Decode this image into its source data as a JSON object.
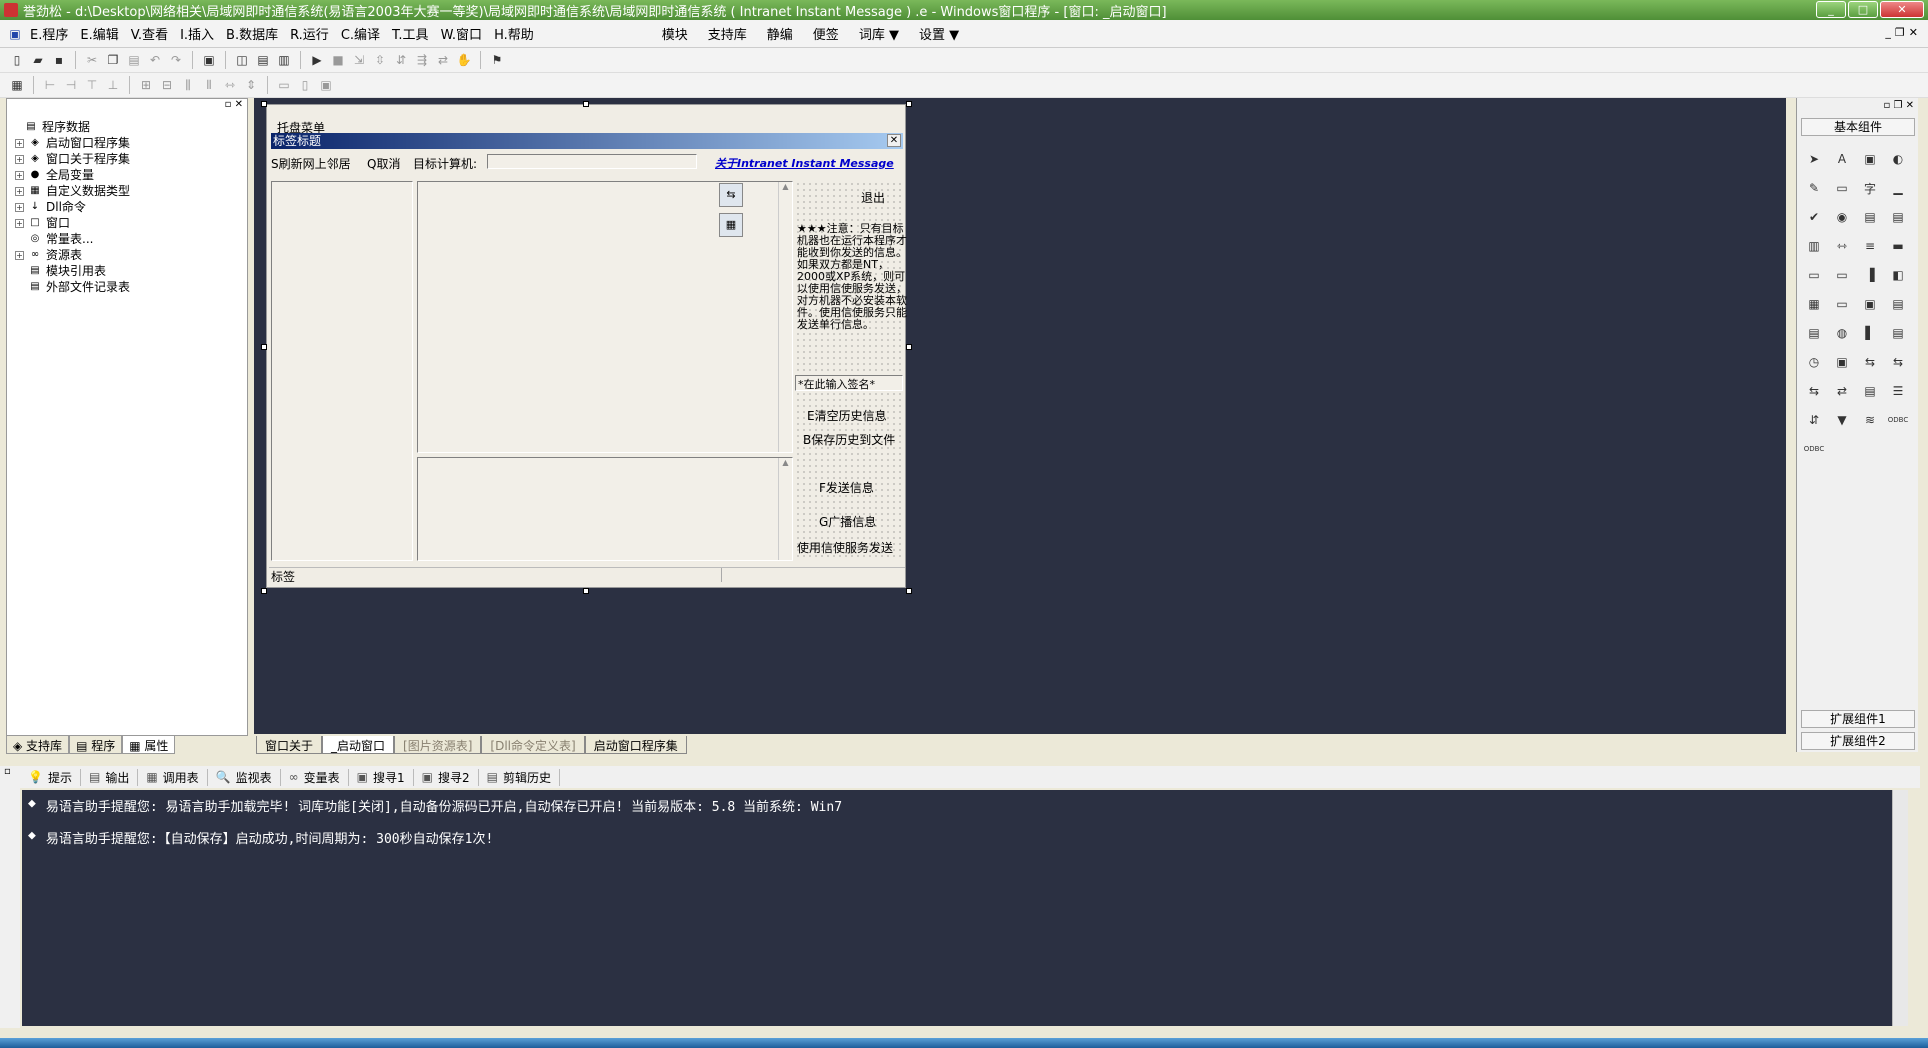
{
  "window": {
    "title": "誉劲松 - d:\\Desktop\\网络相关\\局域网即时通信系统(易语言2003年大赛一等奖)\\局域网即时通信系统\\局域网即时通信系统 ( Intranet Instant Message ) .e - Windows窗口程序 - [窗口: _启动窗口]",
    "controls": {
      "minimize": "_",
      "restore": "□",
      "close": "✕"
    }
  },
  "menubar": {
    "items": [
      "E.程序",
      "E.编辑",
      "V.查看",
      "I.插入",
      "B.数据库",
      "R.运行",
      "C.编译",
      "T.工具",
      "W.窗口",
      "H.帮助"
    ],
    "right_items": [
      "模块",
      "支持库",
      "静编",
      "便签",
      "词库 ▼",
      "设置 ▼"
    ]
  },
  "left_panel": {
    "tree": [
      {
        "label": "程序数据",
        "level": 0,
        "expand": "",
        "icon": "▤"
      },
      {
        "label": "启动窗口程序集",
        "level": 1,
        "expand": "+",
        "icon": "◈"
      },
      {
        "label": "窗口关于程序集",
        "level": 1,
        "expand": "+",
        "icon": "◈"
      },
      {
        "label": "全局变量",
        "level": 1,
        "expand": "+",
        "icon": "●"
      },
      {
        "label": "自定义数据类型",
        "level": 1,
        "expand": "+",
        "icon": "▦"
      },
      {
        "label": "Dll命令",
        "level": 1,
        "expand": "+",
        "icon": "↓"
      },
      {
        "label": "窗口",
        "level": 1,
        "expand": "+",
        "icon": "□"
      },
      {
        "label": "常量表...",
        "level": 1,
        "expand": "",
        "icon": "◎"
      },
      {
        "label": "资源表",
        "level": 1,
        "expand": "+",
        "icon": "∞"
      },
      {
        "label": "模块引用表",
        "level": 1,
        "expand": "",
        "icon": "▤"
      },
      {
        "label": "外部文件记录表",
        "level": 1,
        "expand": "",
        "icon": "▤"
      }
    ],
    "tabs": [
      "支持库",
      "程序",
      "属性"
    ]
  },
  "form_designer": {
    "tray_menu": "托盘菜单",
    "caption": "标签标题",
    "refresh_button": "S刷新网上邻居",
    "cancel_button": "Q取消",
    "target_label": "目标计算机:",
    "about_link": "关于Intranet Instant Message",
    "exit_button": "退出",
    "note_text": "★★★注意：只有目标机器也在运行本程序才能收到你发送的信息。如果双方都是NT，2000或XP系统，则可以使用信使服务发送，对方机器不必安装本软件。使用信使服务只能发送单行信息。",
    "signature_placeholder": "*在此输入签名*",
    "clear_history_button": "E清空历史信息",
    "save_history_button": "B保存历史到文件",
    "send_button": "F发送信息",
    "broadcast_button": "G广播信息",
    "messenger_button": "使用信使服务发送",
    "status_label": "标签"
  },
  "design_tabs": [
    {
      "label": "窗口关于",
      "state": "normal"
    },
    {
      "label": "_启动窗口",
      "state": "active"
    },
    {
      "label": "[图片资源表]",
      "state": "dim"
    },
    {
      "label": "[Dll命令定义表]",
      "state": "dim"
    },
    {
      "label": "启动窗口程序集",
      "state": "normal"
    }
  ],
  "right_panel": {
    "header": "基本组件",
    "extension1": "扩展组件1",
    "extension2": "扩展组件2",
    "components": [
      "➤",
      "A",
      "▣",
      "◐",
      "✎",
      "▭",
      "字",
      "▁",
      "✔",
      "◉",
      "▤",
      "▤",
      "▥",
      "⇿",
      "≡",
      "▬",
      "▭",
      "▭",
      "▐",
      "◧",
      "▦",
      "▭",
      "▣",
      "▤",
      "▤",
      "◍",
      "▌",
      "▤",
      "◷",
      "▣",
      "⇆",
      "⇆",
      "⇆",
      "⇄",
      "▤",
      "☰",
      "⇵",
      "▼",
      "≋",
      "ODBC",
      "ODBC"
    ]
  },
  "output_panel": {
    "tabs": [
      {
        "icon": "💡",
        "label": "提示"
      },
      {
        "icon": "▤",
        "label": "输出"
      },
      {
        "icon": "▦",
        "label": "调用表"
      },
      {
        "icon": "🔍",
        "label": "监视表"
      },
      {
        "icon": "∞",
        "label": "变量表"
      },
      {
        "icon": "▣",
        "label": "搜寻1"
      },
      {
        "icon": "▣",
        "label": "搜寻2"
      },
      {
        "icon": "▤",
        "label": "剪辑历史"
      }
    ],
    "lines": [
      "易语言助手提醒您:  易语言助手加载完毕!  词库功能[关闭],自动备份源码已开启,自动保存已开启!  当前易版本: 5.8  当前系统: Win7",
      "易语言助手提醒您:【自动保存】启动成功,时间周期为: 300秒自动保存1次!"
    ]
  },
  "colors": {
    "design_bg": "#2b3042",
    "form_bg": "#f0ede5",
    "caption_gradient_start": "#0a246a",
    "caption_gradient_end": "#a6caf0",
    "link": "#0000cc"
  }
}
